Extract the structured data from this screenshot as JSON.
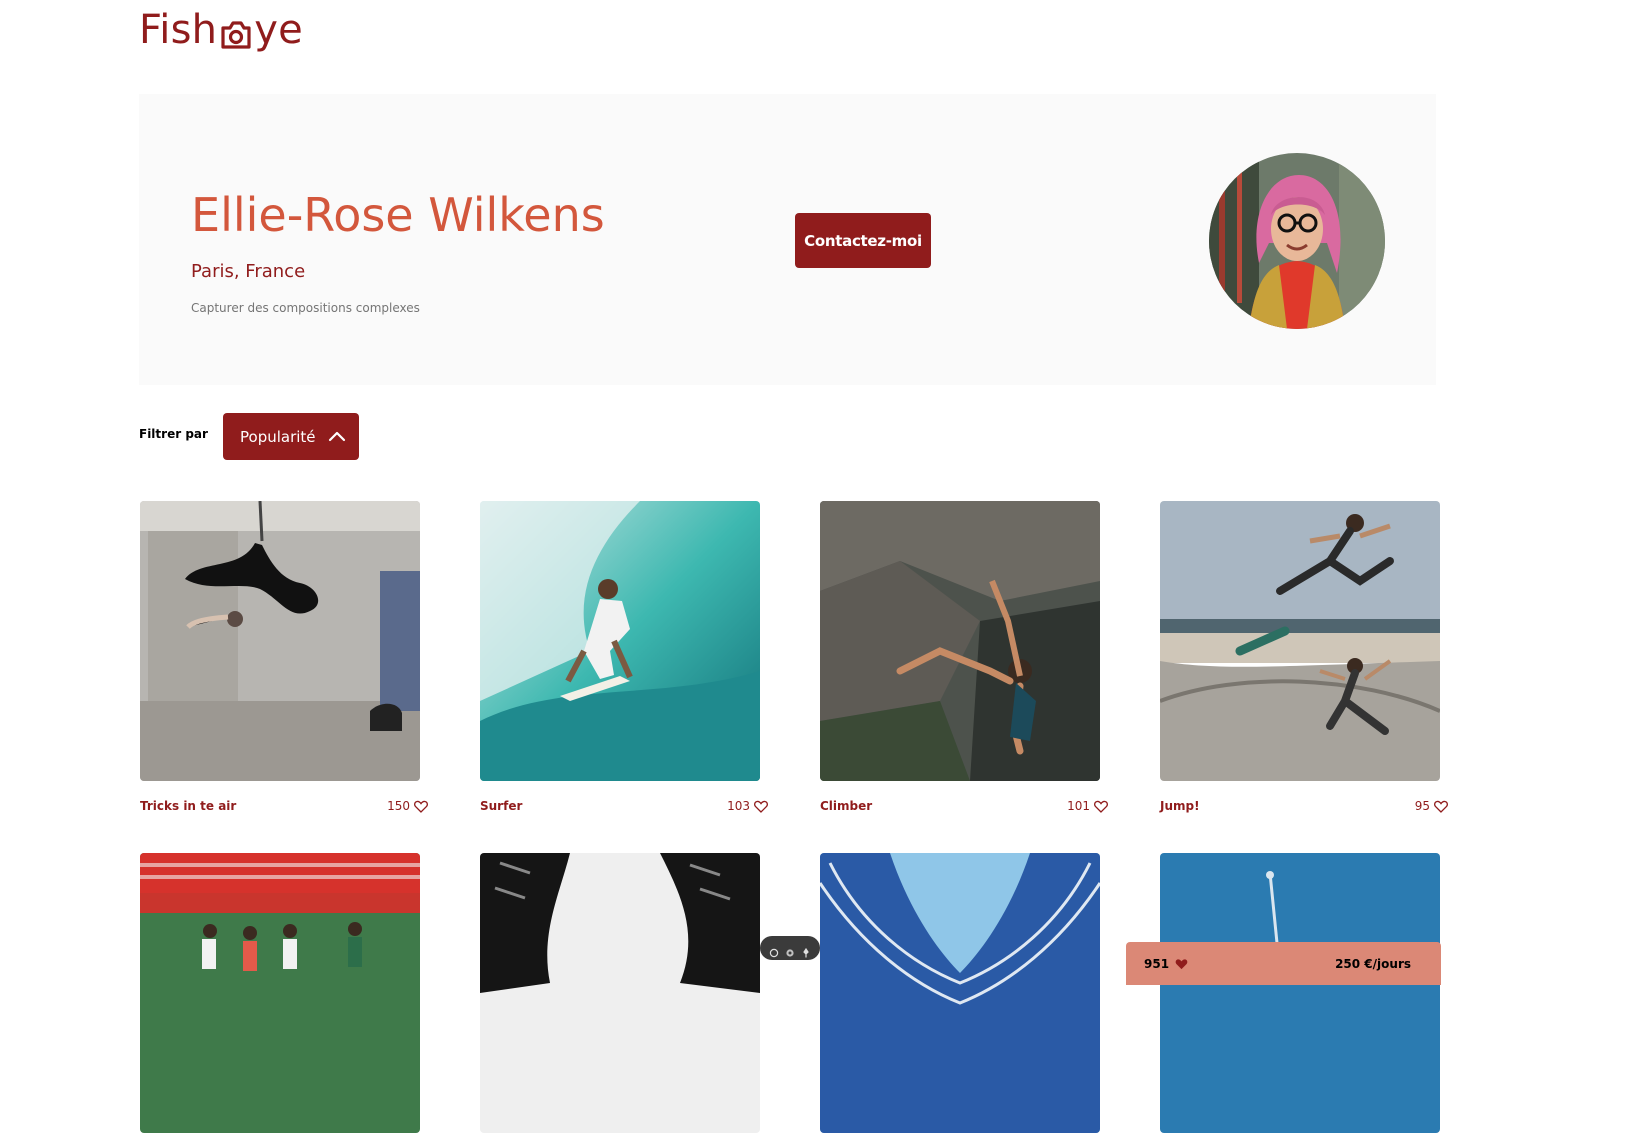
{
  "brand": {
    "logo_left": "Fish",
    "logo_right": "ye",
    "color": "#901C1C"
  },
  "photographer": {
    "name": "Ellie-Rose Wilkens",
    "location": "Paris, France",
    "tagline": "Capturer des compositions complexes",
    "contact_label": "Contactez-moi",
    "avatar_alt": "Ellie-Rose Wilkens"
  },
  "filter": {
    "label": "Filtrer par",
    "selected": "Popularité",
    "icon": "chevron-up-icon"
  },
  "gallery": [
    {
      "title": "Tricks in te air",
      "likes": "150",
      "icon": "heart-outline-icon"
    },
    {
      "title": "Surfer",
      "likes": "103",
      "icon": "heart-outline-icon"
    },
    {
      "title": "Climber",
      "likes": "101",
      "icon": "heart-outline-icon"
    },
    {
      "title": "Jump!",
      "likes": "95",
      "icon": "heart-outline-icon"
    },
    {
      "title": "",
      "likes": "",
      "icon": ""
    },
    {
      "title": "",
      "likes": "",
      "icon": ""
    },
    {
      "title": "",
      "likes": "",
      "icon": ""
    },
    {
      "title": "",
      "likes": "",
      "icon": ""
    }
  ],
  "stats": {
    "total_likes": "951",
    "price": "250 €/jours",
    "icon": "heart-filled-icon"
  },
  "colors": {
    "primary": "#901C1C",
    "secondary": "#D3573C",
    "panel": "#FAFAFA",
    "stats_bg": "#DB8876"
  }
}
